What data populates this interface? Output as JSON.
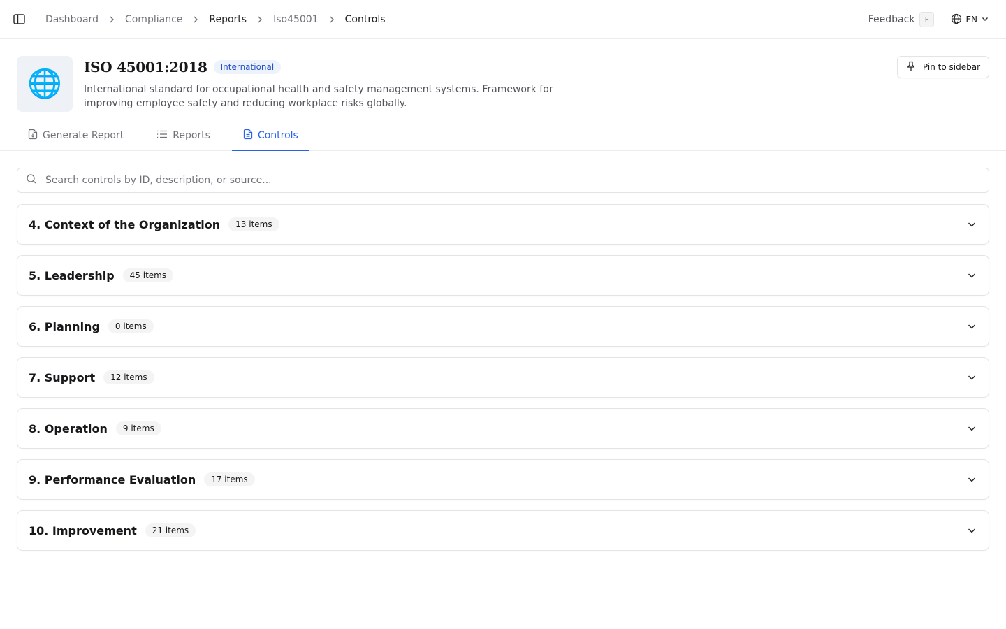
{
  "breadcrumb": [
    "Dashboard",
    "Compliance",
    "Reports",
    "Iso45001",
    "Controls"
  ],
  "topbar": {
    "feedback_label": "Feedback",
    "feedback_shortcut": "F",
    "language": "EN"
  },
  "header": {
    "logo_glyph": "🌐",
    "title": "ISO 45001:2018",
    "badge": "International",
    "description": "International standard for occupational health and safety management systems. Framework for improving employee safety and reducing workplace risks globally.",
    "pin_label": "Pin to sidebar"
  },
  "tabs": [
    {
      "label": "Generate Report",
      "icon": "file-download-icon",
      "active": false
    },
    {
      "label": "Reports",
      "icon": "list-icon",
      "active": false
    },
    {
      "label": "Controls",
      "icon": "document-icon",
      "active": true
    }
  ],
  "search": {
    "placeholder": "Search controls by ID, description, or source...",
    "value": ""
  },
  "sections": [
    {
      "title": "4. Context of the Organization",
      "count": "13 items"
    },
    {
      "title": "5. Leadership",
      "count": "45 items"
    },
    {
      "title": "6. Planning",
      "count": "0 items"
    },
    {
      "title": "7. Support",
      "count": "12 items"
    },
    {
      "title": "8. Operation",
      "count": "9 items"
    },
    {
      "title": "9. Performance Evaluation",
      "count": "17 items"
    },
    {
      "title": "10. Improvement",
      "count": "21 items"
    }
  ],
  "colors": {
    "accent": "#2563eb",
    "badge_bg": "#eef2fb",
    "badge_text": "#2451c9"
  }
}
